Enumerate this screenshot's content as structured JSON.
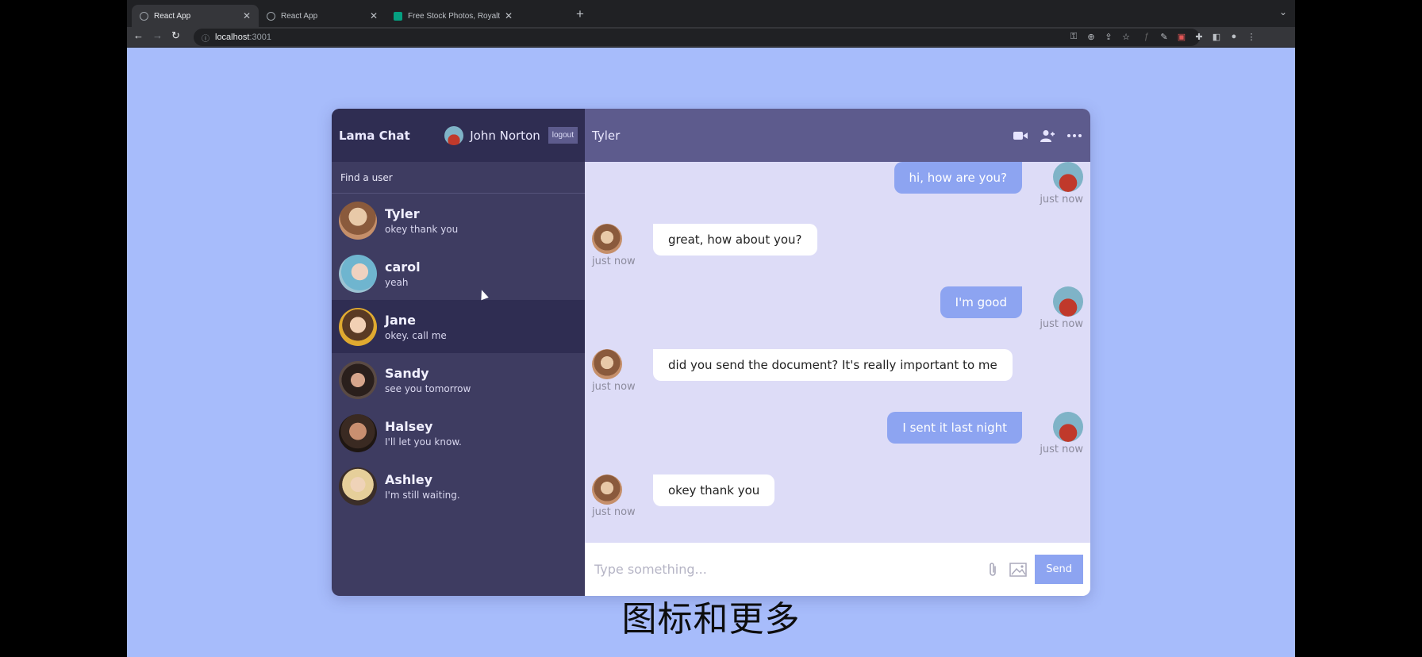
{
  "browser": {
    "tabs": [
      {
        "title": "React App",
        "favicon": "globe-icon",
        "active": true
      },
      {
        "title": "React App",
        "favicon": "globe-icon",
        "active": false
      },
      {
        "title": "Free Stock Photos, Royalty Fre",
        "favicon": "pexels-icon",
        "active": false
      }
    ],
    "url_host": "localhost",
    "url_port": ":3001"
  },
  "sidebar": {
    "brand": "Lama Chat",
    "current_user": "John Norton",
    "logout_label": "logout",
    "search_placeholder": "Find a user",
    "users": [
      {
        "name": "Tyler",
        "last": "okey thank you",
        "avatar": "#c58f6a"
      },
      {
        "name": "carol",
        "last": "yeah",
        "avatar": "#8fb9c9"
      },
      {
        "name": "Jane",
        "last": "okey. call me",
        "avatar": "#d8a43a",
        "selected": true
      },
      {
        "name": "Sandy",
        "last": "see you tomorrow",
        "avatar": "#4a3b35"
      },
      {
        "name": "Halsey",
        "last": "I'll let you know.",
        "avatar": "#6b4a3a"
      },
      {
        "name": "Ashley",
        "last": "I'm still waiting.",
        "avatar": "#cdb48f"
      }
    ]
  },
  "chat": {
    "contact_name": "Tyler",
    "header_icons": [
      "video-camera-icon",
      "add-user-icon",
      "more-icon"
    ],
    "messages": [
      {
        "owner": true,
        "text": "hi, how are you?",
        "time": "just now"
      },
      {
        "owner": false,
        "text": "great, how about you?",
        "time": "just now"
      },
      {
        "owner": true,
        "text": "I'm good",
        "time": "just now"
      },
      {
        "owner": false,
        "text": "did you send the document? It's really important to me",
        "time": "just now"
      },
      {
        "owner": true,
        "text": "I sent it last night",
        "time": "just now"
      },
      {
        "owner": false,
        "text": "okey thank you",
        "time": "just now"
      }
    ],
    "input_placeholder": "Type something...",
    "send_label": "Send"
  },
  "subtitle": "图标和更多",
  "colors": {
    "page_background": "#a7bcfb",
    "sidebar": "#3e3c61",
    "sidebar_header": "#2f2d52",
    "chat_header": "#5d5b8d",
    "chat_background": "#dddcf7",
    "owner_bubble": "#8da4f1"
  }
}
